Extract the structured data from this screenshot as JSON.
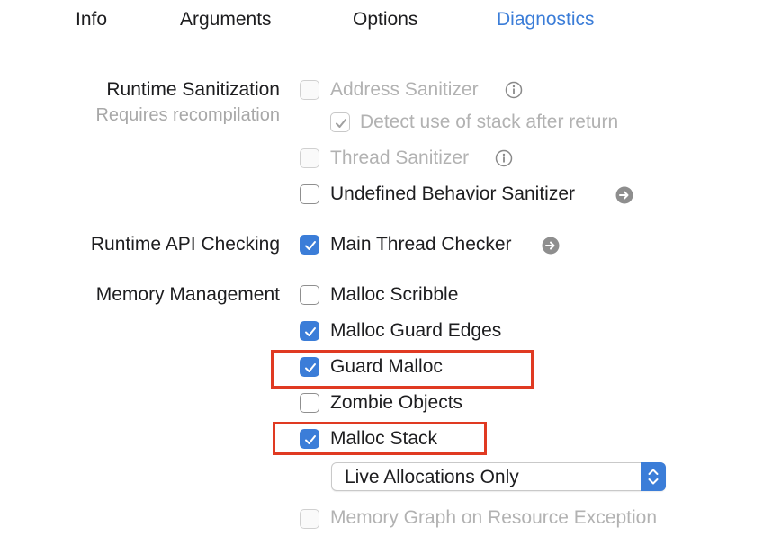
{
  "tabs": [
    {
      "label": "Info",
      "active": false
    },
    {
      "label": "Arguments",
      "active": false
    },
    {
      "label": "Options",
      "active": false
    },
    {
      "label": "Diagnostics",
      "active": true
    }
  ],
  "sections": {
    "runtime_sanitization": {
      "label": "Runtime Sanitization",
      "sublabel": "Requires recompilation",
      "options": [
        {
          "label": "Address Sanitizer",
          "checked": false,
          "enabled": false,
          "icon": "info-icon"
        },
        {
          "label": "Detect use of stack after return",
          "checked": true,
          "enabled": false
        },
        {
          "label": "Thread Sanitizer",
          "checked": false,
          "enabled": false,
          "icon": "info-icon"
        },
        {
          "label": "Undefined Behavior Sanitizer",
          "checked": false,
          "enabled": true,
          "icon": "arrow-circle-icon"
        }
      ]
    },
    "runtime_api_checking": {
      "label": "Runtime API Checking",
      "options": [
        {
          "label": "Main Thread Checker",
          "checked": true,
          "enabled": true,
          "icon": "arrow-circle-icon"
        }
      ]
    },
    "memory_management": {
      "label": "Memory Management",
      "options": [
        {
          "label": "Malloc Scribble",
          "checked": false,
          "enabled": true
        },
        {
          "label": "Malloc Guard Edges",
          "checked": true,
          "enabled": true
        },
        {
          "label": "Guard Malloc",
          "checked": true,
          "enabled": true,
          "highlighted": true
        },
        {
          "label": "Zombie Objects",
          "checked": false,
          "enabled": true
        },
        {
          "label": "Malloc Stack",
          "checked": true,
          "enabled": true,
          "highlighted": true
        }
      ],
      "malloc_stack_mode": {
        "selected": "Live Allocations Only"
      },
      "extra_option": {
        "label": "Memory Graph on Resource Exception",
        "checked": false,
        "enabled": false
      }
    }
  },
  "colors": {
    "accent": "#3b7dd8",
    "highlight_border": "#e03a22",
    "disabled_text": "#b2b2b2",
    "secondary_text": "#a8a8a8"
  }
}
